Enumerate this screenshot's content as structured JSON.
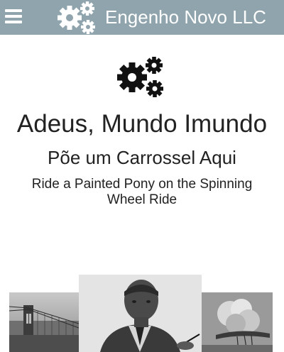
{
  "header": {
    "menu_icon": "hamburger-menu-icon",
    "logo_icon": "gears-icon",
    "title": "Engenho Novo LLC"
  },
  "hero": {
    "icon": "gears-icon",
    "heading": "Adeus, Mundo Imundo",
    "subheading": "Põe um Carrossel Aqui",
    "tagline": "Ride a Painted Pony on the Spinning Wheel Ride"
  },
  "gallery": {
    "photos": [
      "bridge-photo",
      "portrait-photo",
      "airship-photo"
    ]
  },
  "colors": {
    "topbar": "#8fa4ad",
    "text": "#222222",
    "background": "#ffffff"
  }
}
